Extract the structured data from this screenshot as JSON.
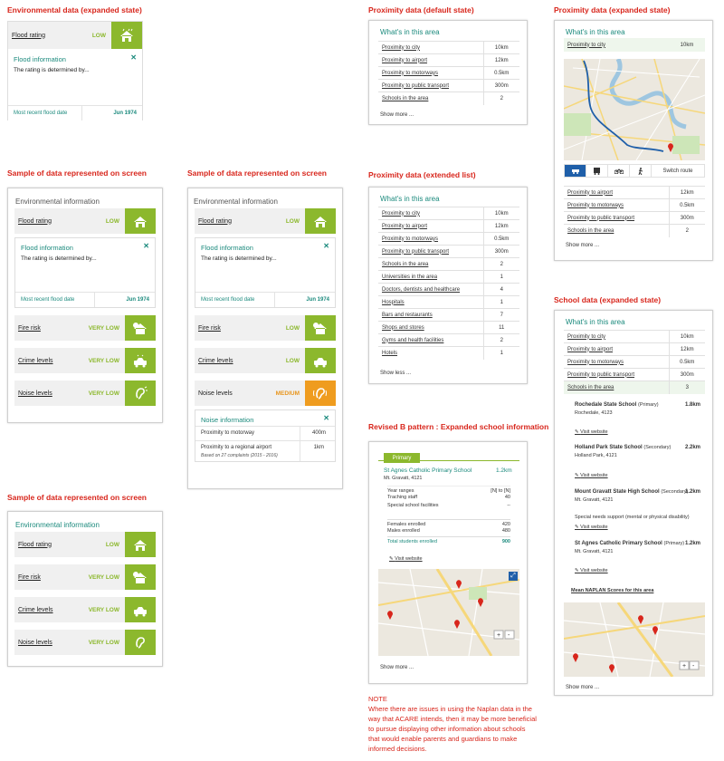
{
  "headings": {
    "env_expanded": "Environmental data (expanded state)",
    "sample1": "Sample of data represented on screen",
    "sample2": "Sample of data represented on screen",
    "sample3": "Sample of data represented on screen",
    "prox_default": "Proximity data (default state)",
    "prox_expanded": "Proximity data (expanded state)",
    "prox_extended": "Proximity data (extended list)",
    "school_expanded": "School data (expanded state)",
    "revised": "Revised B pattern : Expanded school information"
  },
  "env": {
    "title": "Environmental information",
    "flood_label": "Flood rating",
    "flood_value": "LOW",
    "info_title": "Flood information",
    "info_body": "The rating is determined by...",
    "recent_label": "Most recent flood date",
    "recent_value": "Jun 1974",
    "fire_label": "Fire risk",
    "fire_v1": "VERY LOW",
    "fire_v2": "LOW",
    "crime_label": "Crime levels",
    "crime_v1": "VERY LOW",
    "crime_v2": "LOW",
    "noise_label": "Noise levels",
    "noise_v1": "VERY LOW",
    "noise_v2": "MEDIUM",
    "noise_info_title": "Noise information",
    "noise_motorway": "Proximity to motorway",
    "noise_motorway_v": "400m",
    "noise_airport": "Proximity to a regional airport",
    "noise_airport_v": "1km",
    "noise_based": "Based on 27 complaints (2015 - 2016)"
  },
  "prox": {
    "title": "What's in this area",
    "rows": [
      {
        "label": "Proximity to city",
        "value": "10km"
      },
      {
        "label": "Proximity to airport",
        "value": "12km"
      },
      {
        "label": "Proximity to motorways",
        "value": "0.5km"
      },
      {
        "label": "Proximity to public transport",
        "value": "300m"
      },
      {
        "label": "Schools in the area",
        "value": "2"
      }
    ],
    "extra_rows": [
      {
        "label": "Universities in the area",
        "value": "1"
      },
      {
        "label": "Doctors, dentists and healthcare",
        "value": "4"
      },
      {
        "label": "Hospitals",
        "value": "1"
      },
      {
        "label": "Bars and restaurants",
        "value": "7"
      },
      {
        "label": "Shops and stores",
        "value": "11"
      },
      {
        "label": "Gyms and health facilities",
        "value": "2"
      },
      {
        "label": "Hotels",
        "value": "1"
      }
    ],
    "show_more": "Show more ...",
    "show_less": "Show less ...",
    "switch_route": "Switch route"
  },
  "schools_expanded": {
    "schools_value": "3",
    "list": [
      {
        "name": "Rochedale State School",
        "type": "(Primary)",
        "addr": "Rochedale, 4123",
        "dist": "1.8km"
      },
      {
        "name": "Holland Park State School",
        "type": "(Secondary)",
        "addr": "Holland Park, 4121",
        "dist": "2.2km"
      },
      {
        "name": "Mount Gravatt State High School",
        "type": "(Secondary)",
        "addr": "Mt. Gravatt, 4121",
        "dist": "1.2km"
      },
      {
        "name": "St Agnes Catholic Primary School",
        "type": "(Primary)",
        "addr": "Mt. Gravatt, 4121",
        "dist": "1.2km"
      }
    ],
    "special_needs": "Special needs support (mental or physical disability)",
    "visit": "Visit website",
    "naplan": "Mean NAPLAN Scores for this area"
  },
  "revised": {
    "badge": "Primary",
    "school": "St Agnes Catholic Primary School",
    "dist": "1.2km",
    "addr": "Mt. Gravatt, 4121",
    "rows1": [
      {
        "l": "Year ranges",
        "v": "[N] to [N]"
      },
      {
        "l": "Traching staff",
        "v": "40"
      },
      {
        "l": "Special school facilities",
        "v": "--"
      }
    ],
    "rows2": [
      {
        "l": "Females enrolled",
        "v": "420"
      },
      {
        "l": "Males enrolled",
        "v": "480"
      }
    ],
    "total_label": "Total students enrolled",
    "total_value": "900",
    "visit": "Visit website",
    "show_more": "Show more ..."
  },
  "note": {
    "title": "NOTE",
    "body": "Where there are issues in using the Naplan data in the way that ACARE intends, then it may be more beneficial to pursue displaying other information about schools that would enable parents and guardians to make informed decisions."
  },
  "colors": {
    "green": "#8cb82d",
    "teal": "#1b8a7d",
    "red": "#d8261c",
    "orange": "#ef9c1f",
    "route": "#1f5fa9"
  }
}
